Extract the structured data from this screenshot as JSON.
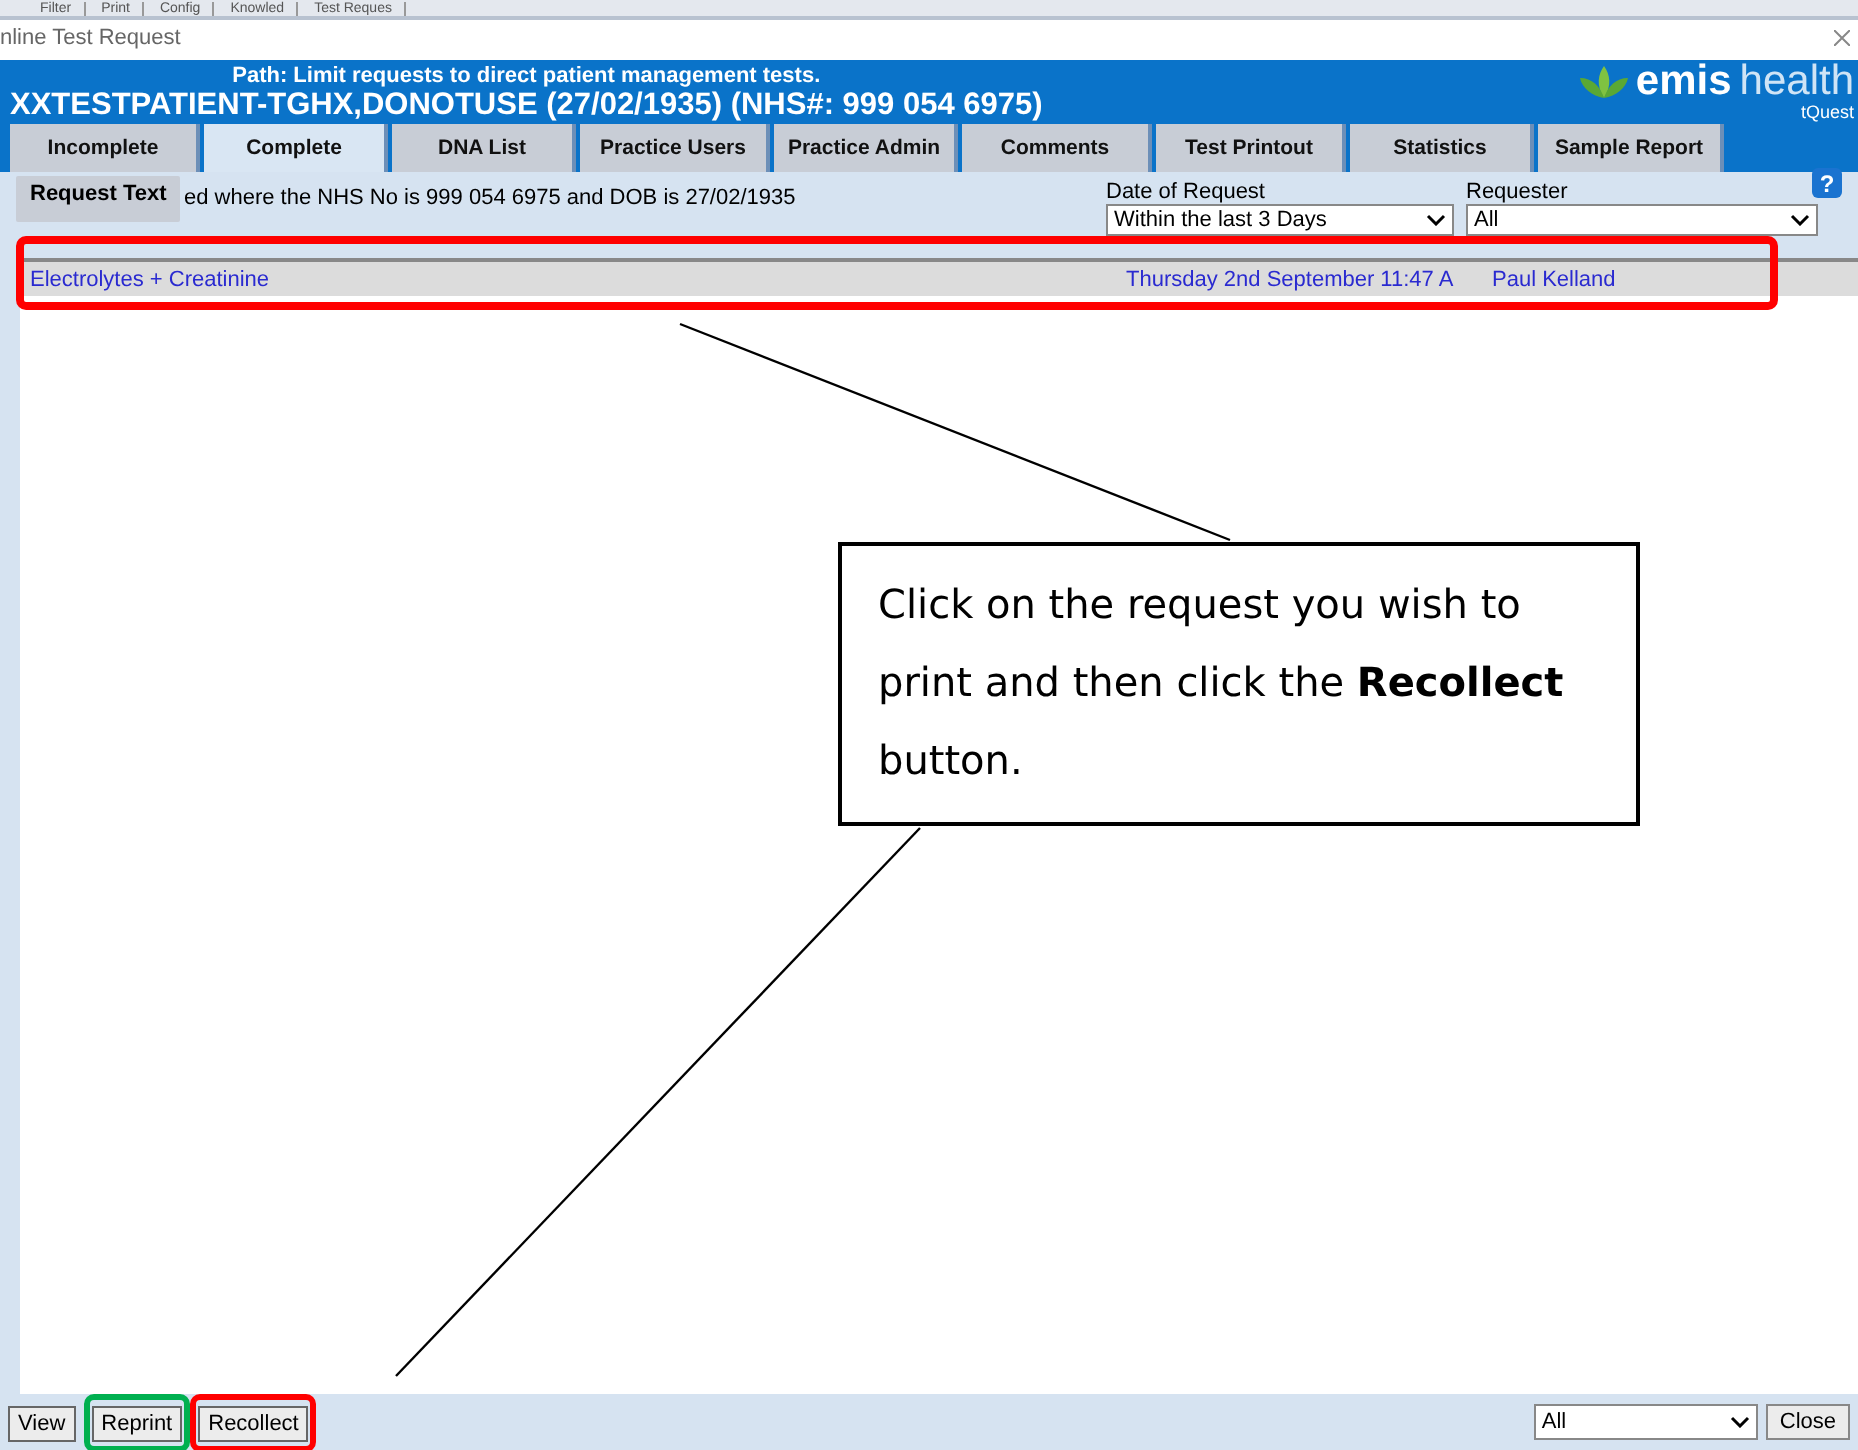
{
  "toolbar_strip": [
    "Filter",
    "Print",
    "Config",
    "Knowled",
    "Test Reques"
  ],
  "window": {
    "title": "nline Test Request"
  },
  "header": {
    "path": "Path: Limit requests to direct patient management tests.",
    "patient": "XXTESTPATIENT-TGHX,DONOTUSE (27/02/1935)  (NHS#: 999 054 6975)",
    "logo_main": "emis",
    "logo_light": "health",
    "logo_sub": "tQuest"
  },
  "tabs": [
    {
      "label": "Incomplete",
      "selected": false
    },
    {
      "label": "Complete",
      "selected": true
    },
    {
      "label": "DNA List",
      "selected": false
    },
    {
      "label": "Practice Users",
      "selected": false
    },
    {
      "label": "Practice Admin",
      "selected": false
    },
    {
      "label": "Comments",
      "selected": false
    },
    {
      "label": "Test Printout",
      "selected": false
    },
    {
      "label": "Statistics",
      "selected": false
    },
    {
      "label": "Sample Report",
      "selected": false
    }
  ],
  "tooltip": "Request Text",
  "info": "ed where the NHS No is 999 054 6975 and DOB is 27/02/1935",
  "filters": [
    {
      "label": "Date of Request",
      "value": "Within the last 3 Days"
    },
    {
      "label": "Requester",
      "value": "All"
    }
  ],
  "help": "?",
  "rows": [
    {
      "test": "Electrolytes + Creatinine",
      "date": "Thursday 2nd September 11:47 A",
      "requester": "Paul Kelland",
      "selected": true
    }
  ],
  "buttons": [
    {
      "label": "View"
    },
    {
      "label": "Reprint",
      "color": "#00b050"
    },
    {
      "label": "Recollect",
      "color": "#ff0000"
    }
  ],
  "bottom_select": "All",
  "close": "Close",
  "callout": "Click on the request you wish to print and then click the **Recollect** button."
}
